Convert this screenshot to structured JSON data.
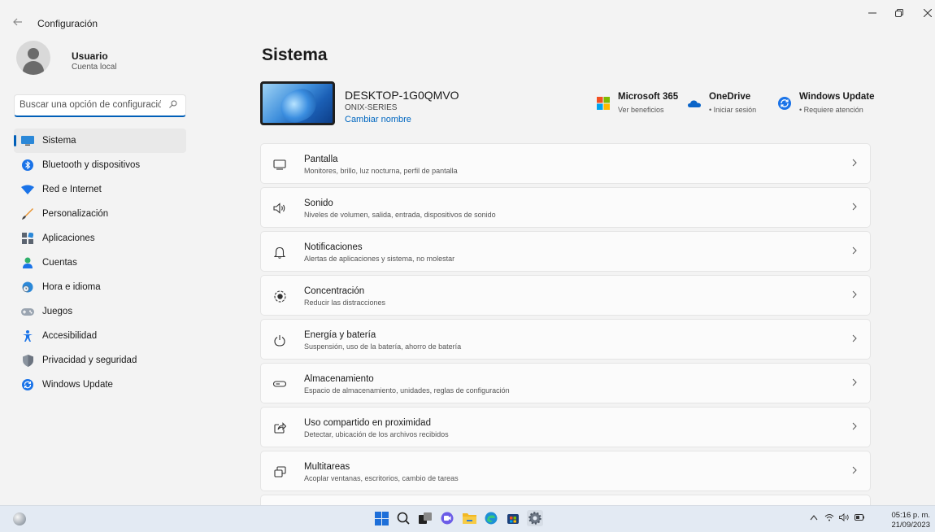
{
  "window": {
    "title": "Configuración",
    "back_icon": "arrow-left-icon",
    "controls": [
      "minimize",
      "restore",
      "close"
    ]
  },
  "profile": {
    "name": "Usuario",
    "account_type": "Cuenta local"
  },
  "search": {
    "placeholder": "Buscar una opción de configuración",
    "icon": "search-icon"
  },
  "sidebar": {
    "items": [
      {
        "label": "Sistema",
        "icon": "system-icon",
        "active": true
      },
      {
        "label": "Bluetooth y dispositivos",
        "icon": "bluetooth-icon"
      },
      {
        "label": "Red e Internet",
        "icon": "wifi-icon"
      },
      {
        "label": "Personalización",
        "icon": "brush-icon"
      },
      {
        "label": "Aplicaciones",
        "icon": "apps-icon"
      },
      {
        "label": "Cuentas",
        "icon": "person-icon"
      },
      {
        "label": "Hora e idioma",
        "icon": "globe-clock-icon"
      },
      {
        "label": "Juegos",
        "icon": "gamepad-icon"
      },
      {
        "label": "Accesibilidad",
        "icon": "accessibility-icon"
      },
      {
        "label": "Privacidad y seguridad",
        "icon": "shield-icon"
      },
      {
        "label": "Windows Update",
        "icon": "windows-update-icon"
      }
    ]
  },
  "main": {
    "title": "Sistema",
    "device": {
      "name": "DESKTOP-1G0QMVO",
      "model": "ONIX-SERIES",
      "rename": "Cambiar nombre"
    },
    "promos": [
      {
        "title": "Microsoft 365",
        "sub": "Ver beneficios",
        "icon": "microsoft-logo-icon"
      },
      {
        "title": "OneDrive",
        "sub": "• Iniciar sesión",
        "icon": "onedrive-cloud-icon"
      },
      {
        "title": "Windows Update",
        "sub": "• Requiere atención",
        "icon": "windows-update-icon"
      }
    ],
    "settings": [
      {
        "title": "Pantalla",
        "desc": "Monitores, brillo, luz nocturna, perfil de pantalla",
        "icon": "display-icon"
      },
      {
        "title": "Sonido",
        "desc": "Niveles de volumen, salida, entrada, dispositivos de sonido",
        "icon": "speaker-icon"
      },
      {
        "title": "Notificaciones",
        "desc": "Alertas de aplicaciones y sistema, no molestar",
        "icon": "bell-icon"
      },
      {
        "title": "Concentración",
        "desc": "Reducir las distracciones",
        "icon": "focus-icon"
      },
      {
        "title": "Energía y batería",
        "desc": "Suspensión, uso de la batería, ahorro de batería",
        "icon": "power-icon"
      },
      {
        "title": "Almacenamiento",
        "desc": "Espacio de almacenamiento, unidades, reglas de configuración",
        "icon": "storage-icon"
      },
      {
        "title": "Uso compartido en proximidad",
        "desc": "Detectar, ubicación de los archivos recibidos",
        "icon": "share-icon"
      },
      {
        "title": "Multitareas",
        "desc": "Acoplar ventanas, escritorios, cambio de tareas",
        "icon": "multitask-icon"
      }
    ]
  },
  "taskbar": {
    "apps": [
      "windows-start-icon",
      "search-icon",
      "task-view-icon",
      "chat-icon",
      "file-explorer-icon",
      "edge-icon",
      "store-icon",
      "settings-gear-icon"
    ],
    "time": "05:16 p. m.",
    "date": "21/09/2023"
  },
  "colors": {
    "accent": "#005fb8",
    "link": "#0067c0",
    "background": "#f3f3f3",
    "card": "#fbfbfb"
  }
}
